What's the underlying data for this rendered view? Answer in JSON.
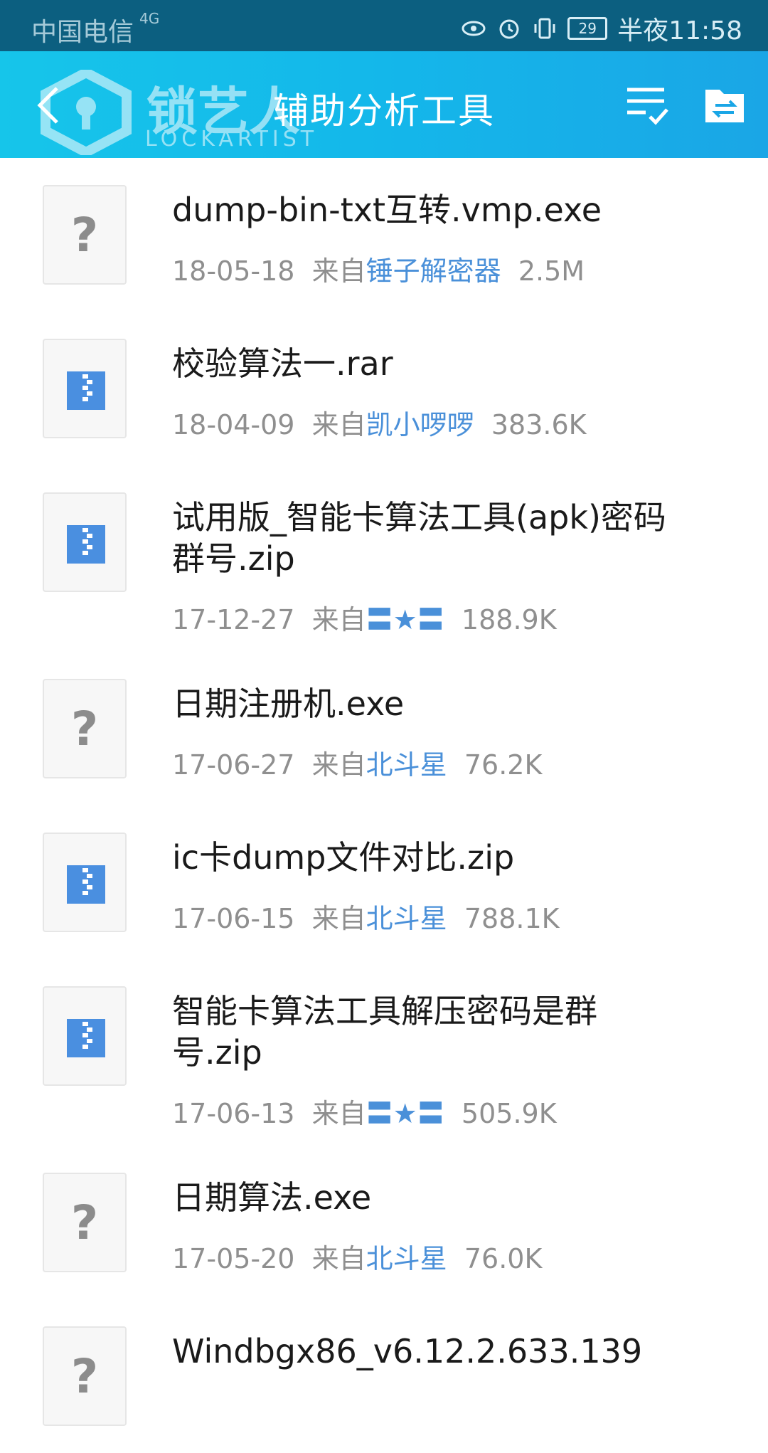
{
  "status_bar": {
    "carrier": "中国电信",
    "network": "4G",
    "battery": "29",
    "time": "半夜11:58"
  },
  "header": {
    "title": "辅助分析工具",
    "watermark_cn": "锁艺人",
    "watermark_en": "LOCKARTIST"
  },
  "files": [
    {
      "name": "dump-bin-txt互转.vmp.exe",
      "date": "18-05-18",
      "from": "来自",
      "user": "锤子解密器",
      "size": "2.5M",
      "icon": "unknown-file-icon"
    },
    {
      "name": "校验算法一.rar",
      "date": "18-04-09",
      "from": "来自",
      "user": "凯小啰啰",
      "size": "383.6K",
      "icon": "archive-file-icon"
    },
    {
      "name": "试用版_智能卡算法工具(apk)密码群号.zip",
      "date": "17-12-27",
      "from": "来自",
      "user": "〓★〓",
      "size": "188.9K",
      "icon": "archive-file-icon"
    },
    {
      "name": "日期注册机.exe",
      "date": "17-06-27",
      "from": "来自",
      "user": "北斗星",
      "size": "76.2K",
      "icon": "unknown-file-icon"
    },
    {
      "name": "ic卡dump文件对比.zip",
      "date": "17-06-15",
      "from": "来自",
      "user": "北斗星",
      "size": "788.1K",
      "icon": "archive-file-icon"
    },
    {
      "name": "智能卡算法工具解压密码是群号.zip",
      "date": "17-06-13",
      "from": "来自",
      "user": "〓★〓",
      "size": "505.9K",
      "icon": "archive-file-icon"
    },
    {
      "name": "日期算法.exe",
      "date": "17-05-20",
      "from": "来自",
      "user": "北斗星",
      "size": "76.0K",
      "icon": "unknown-file-icon"
    },
    {
      "name": "Windbgx86_v6.12.2.633.139",
      "date": "",
      "from": "",
      "user": "",
      "size": "",
      "icon": "unknown-file-icon"
    }
  ],
  "colors": {
    "header_start": "#16c5ea",
    "header_end": "#1aa6e6",
    "status_bar": "#0c5f80",
    "user_link": "#4a90d9",
    "meta_text": "#8f8f8f",
    "archive_icon": "#4a8fe0"
  }
}
